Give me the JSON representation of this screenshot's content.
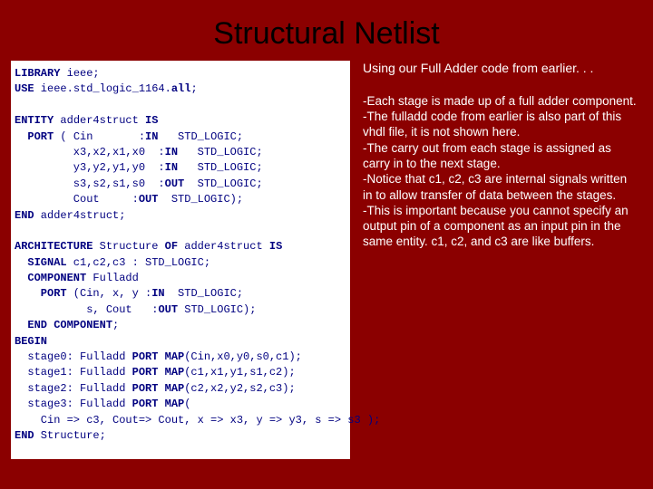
{
  "title": "Structural Netlist",
  "code": {
    "l1a": "LIBRARY",
    "l1b": " ieee;",
    "l2a": "USE",
    "l2b": " ieee.std_logic_1164.",
    "l2c": "all",
    "l2d": ";",
    "l3a": "ENTITY",
    "l3b": " adder4struct ",
    "l3c": "IS",
    "l4a": "  PORT",
    "l4b": " ( Cin       :",
    "l4c": "IN",
    "l4d": "   STD_LOGIC;",
    "l5a": "         x3,x2,x1,x0  :",
    "l5b": "IN",
    "l5c": "   STD_LOGIC;",
    "l6a": "         y3,y2,y1,y0  :",
    "l6b": "IN",
    "l6c": "   STD_LOGIC;",
    "l7a": "         s3,s2,s1,s0  :",
    "l7b": "OUT",
    "l7c": "  STD_LOGIC;",
    "l8a": "         Cout     :",
    "l8b": "OUT",
    "l8c": "  STD_LOGIC);",
    "l9a": "END",
    "l9b": " adder4struct;",
    "l10a": "ARCHITECTURE",
    "l10b": " Structure ",
    "l10c": "OF",
    "l10d": " adder4struct ",
    "l10e": "IS",
    "l11a": "  SIGNAL",
    "l11b": " c1,c2,c3 : STD_LOGIC;",
    "l12a": "  COMPONENT",
    "l12b": " Fulladd",
    "l13a": "    PORT",
    "l13b": " (Cin, x, y :",
    "l13c": "IN",
    "l13d": "  STD_LOGIC;",
    "l14a": "           s, Cout   :",
    "l14b": "OUT",
    "l14c": " STD_LOGIC);",
    "l15a": "  END COMPONENT",
    "l15b": ";",
    "l16a": "BEGIN",
    "l17a": "  stage0: Fulladd ",
    "l17b": "PORT MAP",
    "l17c": "(Cin,x0,y0,s0,c1);",
    "l18a": "  stage1: Fulladd ",
    "l18b": "PORT MAP",
    "l18c": "(c1,x1,y1,s1,c2);",
    "l19a": "  stage2: Fulladd ",
    "l19b": "PORT MAP",
    "l19c": "(c2,x2,y2,s2,c3);",
    "l20a": "  stage3: Fulladd ",
    "l20b": "PORT MAP",
    "l20c": "(",
    "l21a": "    Cin => c3, Cout=> Cout, x => x3, y => y3, s => s3 );",
    "l22a": "END",
    "l22b": " Structure;"
  },
  "intro": "Using our Full Adder code from earlier. . .",
  "bullets": "-Each stage is made up of a full adder component.\n-The fulladd code from earlier is also part of this vhdl file, it is not shown here.\n-The carry out from each stage is assigned as carry in to the next stage.\n-Notice that c1, c2, c3 are internal signals written in to allow transfer of data between the stages.\n-This is important because you cannot specify an output pin of a component as an input pin in the same entity.  c1, c2, and c3 are like buffers."
}
